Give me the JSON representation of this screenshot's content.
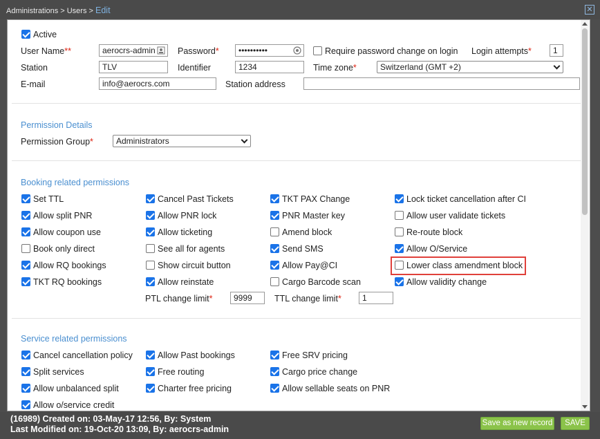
{
  "titlebar": {
    "crumb_prefix": "Administrations > Users >",
    "crumb_current": "Edit",
    "close_glyph": "✕"
  },
  "user": {
    "active_label": "Active",
    "active": true,
    "username_label": "User Name",
    "username_req": "**",
    "username_value": "aerocrs-admin",
    "password_label": "Password",
    "password_req": "*",
    "password_value": "••••••••••",
    "require_pw_label": "Require password change on login",
    "login_attempts_label": "Login attempts",
    "login_attempts_req": "*",
    "login_attempts_value": "1",
    "station_label": "Station",
    "station_value": "TLV",
    "identifier_label": "Identifier",
    "identifier_value": "1234",
    "timezone_label": "Time zone",
    "timezone_req": "*",
    "timezone_value": "Switzerland (GMT +2)",
    "email_label": "E-mail",
    "email_value": "info@aerocrs.com",
    "station_address_label": "Station address",
    "station_address_value": ""
  },
  "permission_details": {
    "title": "Permission Details",
    "group_label": "Permission Group",
    "group_req": "*",
    "group_value": "Administrators"
  },
  "booking": {
    "title": "Booking related permissions",
    "items": [
      {
        "label": "Set TTL",
        "checked": true
      },
      {
        "label": "Cancel Past Tickets",
        "checked": true
      },
      {
        "label": "TKT PAX Change",
        "checked": true
      },
      {
        "label": "Lock ticket cancellation after CI",
        "checked": true
      },
      {
        "label": "Allow split PNR",
        "checked": true
      },
      {
        "label": "Allow PNR lock",
        "checked": true
      },
      {
        "label": "PNR Master key",
        "checked": true
      },
      {
        "label": "Allow user validate tickets",
        "checked": false
      },
      {
        "label": "Allow coupon use",
        "checked": true
      },
      {
        "label": "Allow ticketing",
        "checked": true
      },
      {
        "label": "Amend block",
        "checked": false
      },
      {
        "label": "Re-route block",
        "checked": false
      },
      {
        "label": "Book only direct",
        "checked": false
      },
      {
        "label": "See all for agents",
        "checked": false
      },
      {
        "label": "Send SMS",
        "checked": true
      },
      {
        "label": "Allow O/Service",
        "checked": true
      },
      {
        "label": "Allow RQ bookings",
        "checked": true
      },
      {
        "label": "Show circuit button",
        "checked": false
      },
      {
        "label": "Allow Pay@CI",
        "checked": true
      },
      {
        "label": "Lower class amendment block",
        "checked": false
      },
      {
        "label": "TKT RQ bookings",
        "checked": true
      },
      {
        "label": "Allow reinstate",
        "checked": true
      },
      {
        "label": "Cargo Barcode scan",
        "checked": false
      },
      {
        "label": "Allow validity change",
        "checked": true
      }
    ],
    "ptl_label": "PTL change limit",
    "ptl_req": "*",
    "ptl_value": "9999",
    "ttl_label": "TTL change limit",
    "ttl_req": "*",
    "ttl_value": "1"
  },
  "service": {
    "title": "Service related permissions",
    "items": [
      {
        "label": "Cancel cancellation policy",
        "checked": true
      },
      {
        "label": "Allow Past bookings",
        "checked": true
      },
      {
        "label": "Free SRV pricing",
        "checked": true
      },
      {
        "label": "Split services",
        "checked": true
      },
      {
        "label": "Free routing",
        "checked": true
      },
      {
        "label": "Cargo price change",
        "checked": true
      },
      {
        "label": "Allow unbalanced split",
        "checked": true
      },
      {
        "label": "Charter free pricing",
        "checked": true
      },
      {
        "label": "Allow sellable seats on PNR",
        "checked": true
      },
      {
        "label": "Allow o/service credit",
        "checked": true
      }
    ]
  },
  "footer": {
    "created": "(16989) Created on: 03-May-17 12:56, By: System",
    "modified": "Last Modified on: 19-Oct-20 13:09, By: aerocrs-admin",
    "save_new_label": "Save as new record",
    "save_label": "SAVE",
    "button_color": "#8bc34a"
  }
}
